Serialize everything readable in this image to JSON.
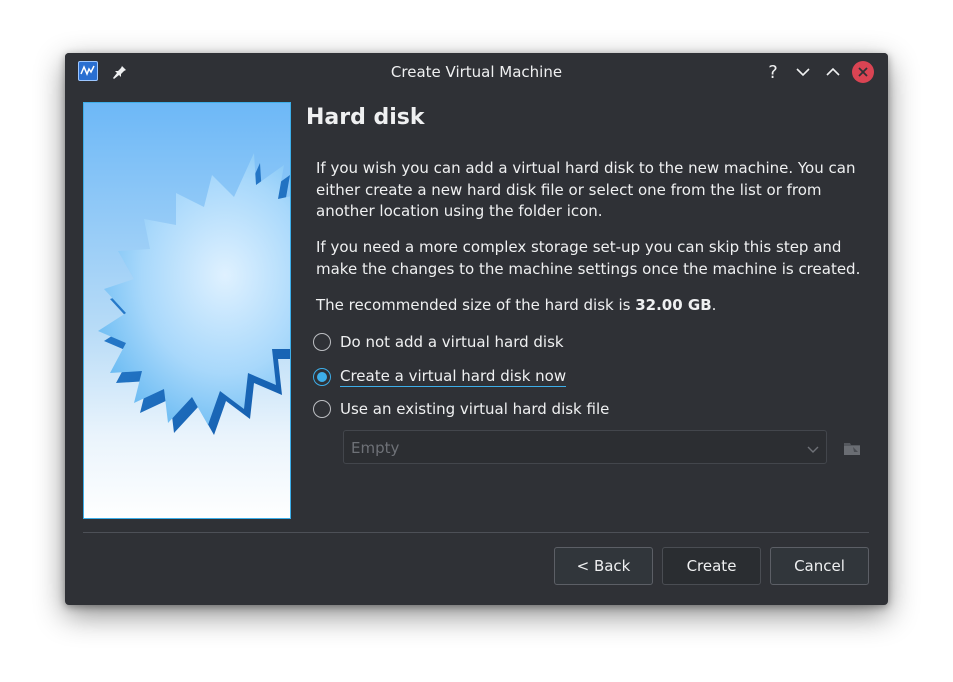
{
  "window": {
    "title": "Create Virtual Machine"
  },
  "titlebar": {
    "app_icon": "virtualbox-icon",
    "pin_icon": "pin-icon",
    "help_icon": "help-icon",
    "minimize_icon": "chevron-down-icon",
    "maximize_icon": "chevron-up-icon",
    "close_icon": "close-icon"
  },
  "page": {
    "title": "Hard disk",
    "paragraph1": "If you wish you can add a virtual hard disk to the new machine. You can either create a new hard disk file or select one from the list or from another location using the folder icon.",
    "paragraph2": "If you need a more complex storage set-up you can skip this step and make the changes to the machine settings once the machine is created.",
    "recommended_prefix": "The recommended size of the hard disk is ",
    "recommended_size": "32.00 GB",
    "recommended_suffix": "."
  },
  "options": [
    {
      "label": "Do not add a virtual hard disk",
      "checked": false
    },
    {
      "label": "Create a virtual hard disk now",
      "checked": true
    },
    {
      "label": "Use an existing virtual hard disk file",
      "checked": false
    }
  ],
  "disk_select": {
    "value": "Empty",
    "enabled": false
  },
  "buttons": {
    "back": "< Back",
    "create": "Create",
    "cancel": "Cancel"
  },
  "colors": {
    "accent": "#3daee9",
    "window_bg": "#2f3136",
    "close": "#da4453"
  }
}
